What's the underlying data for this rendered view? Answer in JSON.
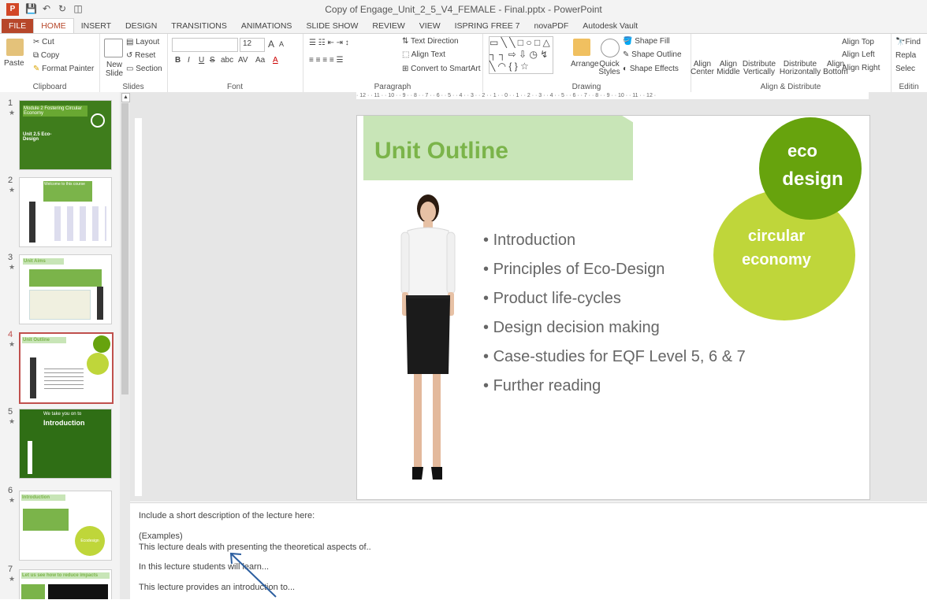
{
  "window": {
    "title": "Copy of Engage_Unit_2_5_V4_FEMALE - Final.pptx - PowerPoint",
    "app_icon_text": "P"
  },
  "tabs": [
    "FILE",
    "HOME",
    "INSERT",
    "DESIGN",
    "TRANSITIONS",
    "ANIMATIONS",
    "SLIDE SHOW",
    "REVIEW",
    "VIEW",
    "ISPRING FREE 7",
    "novaPDF",
    "Autodesk Vault"
  ],
  "ribbon": {
    "clipboard": {
      "label": "Clipboard",
      "paste": "Paste",
      "cut": "Cut",
      "copy": "Copy",
      "format_painter": "Format Painter"
    },
    "slides": {
      "label": "Slides",
      "new_slide": "New Slide",
      "layout": "Layout",
      "reset": "Reset",
      "section": "Section"
    },
    "font": {
      "label": "Font",
      "size": "12",
      "bold": "B",
      "italic": "I",
      "underline": "U",
      "strike": "S",
      "abc": "abc",
      "av": "AV",
      "aa": "Aa",
      "grow": "A",
      "shrink": "A",
      "font_color": "A"
    },
    "paragraph": {
      "label": "Paragraph",
      "text_direction": "Text Direction",
      "align_text": "Align Text",
      "convert_smartart": "Convert to SmartArt"
    },
    "drawing": {
      "label": "Drawing",
      "arrange": "Arrange",
      "quick_styles": "Quick Styles",
      "shape_fill": "Shape Fill",
      "shape_outline": "Shape Outline",
      "shape_effects": "Shape Effects"
    },
    "align": {
      "label": "Align & Distribute",
      "center": "Align Center",
      "middle": "Align Middle",
      "dist_v": "Distribute Vertically",
      "dist_h": "Distribute Horizontally",
      "bottom": "Align Bottom",
      "top": "Align Top",
      "left": "Align Left",
      "right": "Align Right"
    },
    "editing": {
      "label": "Editin",
      "find": "Find",
      "replace": "Repla",
      "select": "Selec"
    }
  },
  "thumbnails": [
    {
      "num": "1",
      "title": "Module 2 Fostering Circular Economy",
      "sub": "Unit 2.5 Eco-Design"
    },
    {
      "num": "2",
      "title": "Welcome to this course"
    },
    {
      "num": "3",
      "title": "Unit Aims"
    },
    {
      "num": "4",
      "title": "Unit Outline"
    },
    {
      "num": "5",
      "title": "We take you on to",
      "sub": "Introduction"
    },
    {
      "num": "6",
      "title": "Introduction",
      "sub": "Ecodesign"
    },
    {
      "num": "7",
      "title": "Let us see how to reduce impacts"
    }
  ],
  "slide": {
    "title": "Unit Outline",
    "circle_top": [
      "eco",
      "design"
    ],
    "circle_bottom": [
      "circular",
      "economy"
    ],
    "bullets": [
      "Introduction",
      "Principles of Eco-Design",
      "Product life-cycles",
      "Design decision making",
      "Case-studies for EQF Level 5, 6 & 7",
      "Further reading"
    ]
  },
  "notes": [
    "Include a short description of the lecture here:",
    "(Examples)",
    "This lecture deals with presenting the theoretical aspects of..",
    "In this lecture students will learn...",
    "This lecture provides an introduction to..."
  ],
  "ruler_h": "· 12 · · 11 · · 10 · · 9 · · 8 · · 7 · · 6 · · 5 · · 4 · · 3 · · 2 · · 1 · · 0 · · 1 · · 2 · · 3 · · 4 · · 5 · · 6 · · 7 · · 8 · · 9 · · 10 · · 11 · · 12 ·",
  "colors": {
    "accent": "#b7472a",
    "title_green": "#7bb44a",
    "band_green": "#c8e5b7",
    "circle_dark": "#67a30d",
    "circle_light": "#bfd63a",
    "selected_border": "#c0504d"
  }
}
